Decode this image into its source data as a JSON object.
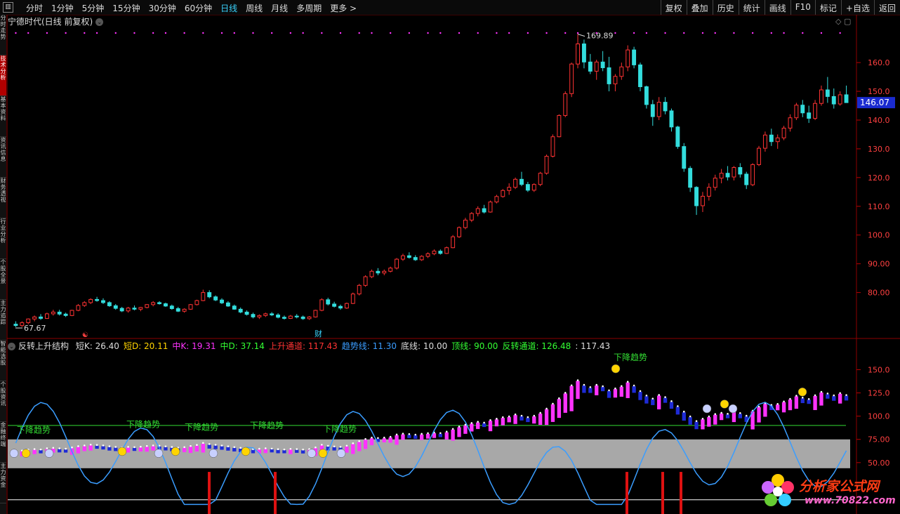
{
  "toolbar": {
    "menu_icon": "menu-icon",
    "periods": [
      "分时",
      "1分钟",
      "5分钟",
      "15分钟",
      "30分钟",
      "60分钟",
      "日线",
      "周线",
      "月线",
      "多周期",
      "更多 >"
    ],
    "active_period": "日线",
    "actions": [
      "复权",
      "叠加",
      "历史",
      "统计",
      "画线",
      "F10",
      "标记",
      "+自选",
      "返回"
    ]
  },
  "sidebar": {
    "tabs": [
      "分时走势",
      "技术分析",
      "基本资料",
      "资讯信息",
      "财务透视",
      "行业分析",
      "个股全景",
      "主力追踪",
      "智能选股",
      "个股资讯",
      "金融终端",
      "主力资金"
    ],
    "active_index": 1
  },
  "main_title": "宁德时代(日线 前复权)",
  "price_axis": {
    "labels": [
      "160.0",
      "150.0",
      "140.0",
      "130.0",
      "120.0",
      "110.0",
      "100.0",
      "90.00",
      "80.00"
    ],
    "current_price": "146.07",
    "high_mark": "169.89",
    "low_mark": "67.67",
    "event_marks": [
      "财",
      "☯"
    ]
  },
  "indicator": {
    "name": "反转上升结构",
    "fields": [
      {
        "label": "短K:",
        "value": "26.40",
        "color": "#dddddd"
      },
      {
        "label": "短D:",
        "value": "20.11",
        "color": "#ffd400"
      },
      {
        "label": "中K:",
        "value": "19.31",
        "color": "#ff33ff"
      },
      {
        "label": "中D:",
        "value": "37.14",
        "color": "#33ff33"
      },
      {
        "label": "上升通道:",
        "value": "117.43",
        "color": "#ff3333"
      },
      {
        "label": "趋势线:",
        "value": "11.30",
        "color": "#3a9dff"
      },
      {
        "label": "底线:",
        "value": "10.00",
        "color": "#dddddd"
      },
      {
        "label": "顶线:",
        "value": "90.00",
        "color": "#33ff33"
      },
      {
        "label": "反转通道:",
        "value": "126.48",
        "color": "#33ff33"
      },
      {
        "label": ":",
        "value": "117.43",
        "color": "#dddddd"
      }
    ],
    "axis_labels": [
      "150.0",
      "125.0",
      "100.0",
      "75.00",
      "50.00"
    ],
    "annotations": [
      "下降趋势",
      "下降趋势",
      "下降趋势",
      "下降趋势",
      "下降趋势",
      "下降趋势"
    ]
  },
  "watermark": {
    "line1": "分析家公式网",
    "line2": "www.70822.com"
  },
  "colors": {
    "up": "#ff3333",
    "down": "#33dddd",
    "magenta": "#ff33ff",
    "blue": "#1e2bd6",
    "trend": "#3a9dff",
    "grid": "#8b0000"
  },
  "chart_data": {
    "type": "candlestick",
    "title": "宁德时代(日线 前复权)",
    "ylim": [
      65,
      172
    ],
    "candles": [
      [
        69,
        70,
        68,
        68.5
      ],
      [
        68.5,
        70,
        68,
        69.5
      ],
      [
        69.5,
        71,
        69,
        70.8
      ],
      [
        70.8,
        72,
        70,
        71.5
      ],
      [
        71.5,
        72.5,
        70.5,
        71
      ],
      [
        71,
        73,
        70.8,
        72.6
      ],
      [
        72.6,
        74,
        72,
        73.2
      ],
      [
        73.2,
        74,
        72,
        72.5
      ],
      [
        72.5,
        73,
        71.5,
        72
      ],
      [
        72,
        74,
        71.8,
        73.8
      ],
      [
        73.8,
        76,
        73.5,
        75.5
      ],
      [
        75.5,
        77,
        75,
        76.5
      ],
      [
        76.5,
        78,
        76,
        77.6
      ],
      [
        77.6,
        78.5,
        76.8,
        77.2
      ],
      [
        77.2,
        78,
        76,
        76.5
      ],
      [
        76.5,
        77,
        75,
        75.4
      ],
      [
        75.4,
        76,
        74,
        74.5
      ],
      [
        74.5,
        75,
        73.2,
        73.6
      ],
      [
        73.6,
        75,
        73,
        74.6
      ],
      [
        74.6,
        75.5,
        73.8,
        74.2
      ],
      [
        74.2,
        75,
        73.5,
        74.8
      ],
      [
        74.8,
        76,
        74.5,
        75.8
      ],
      [
        75.8,
        77,
        75.2,
        76.5
      ],
      [
        76.5,
        77,
        75.8,
        76.1
      ],
      [
        76.1,
        76.5,
        75,
        75.3
      ],
      [
        75.3,
        75.8,
        74,
        74.4
      ],
      [
        74.4,
        75,
        73.2,
        73.5
      ],
      [
        73.5,
        74.5,
        73,
        74.2
      ],
      [
        74.2,
        76,
        74,
        75.8
      ],
      [
        75.8,
        77.5,
        75.5,
        77.2
      ],
      [
        77.2,
        81,
        77,
        80
      ],
      [
        80,
        80.8,
        78,
        78.5
      ],
      [
        78.5,
        79,
        77,
        77.4
      ],
      [
        77.4,
        78,
        76,
        76.4
      ],
      [
        76.4,
        77,
        75,
        75.3
      ],
      [
        75.3,
        75.8,
        74,
        74.2
      ],
      [
        74.2,
        74.8,
        72.8,
        73.2
      ],
      [
        73.2,
        73.8,
        72,
        72.4
      ],
      [
        72.4,
        73,
        71,
        71.5
      ],
      [
        71.5,
        72.4,
        70.8,
        72
      ],
      [
        72,
        73,
        71.5,
        72.6
      ],
      [
        72.6,
        73.2,
        71.8,
        72.2
      ],
      [
        72.2,
        72.8,
        71,
        71.4
      ],
      [
        71.4,
        72,
        70.6,
        71
      ],
      [
        71,
        72.2,
        70.8,
        71.8
      ],
      [
        71.8,
        72.5,
        71,
        71.5
      ],
      [
        71.5,
        72,
        70.5,
        70.9
      ],
      [
        70.9,
        71.8,
        70.5,
        71.5
      ],
      [
        71.5,
        74,
        71.3,
        73.8
      ],
      [
        73.8,
        78,
        73.5,
        77.5
      ],
      [
        77.5,
        78.2,
        75.5,
        76
      ],
      [
        76,
        76.8,
        74.8,
        75.2
      ],
      [
        75.2,
        75.8,
        74,
        74.6
      ],
      [
        74.6,
        76.5,
        74.3,
        76.2
      ],
      [
        76.2,
        80,
        76,
        79.5
      ],
      [
        79.5,
        83,
        79,
        82.5
      ],
      [
        82.5,
        86,
        82,
        85.5
      ],
      [
        85.5,
        88,
        85,
        87.4
      ],
      [
        87.4,
        88.5,
        86,
        86.8
      ],
      [
        86.8,
        88,
        86,
        87.4
      ],
      [
        87.4,
        89,
        87,
        88.5
      ],
      [
        88.5,
        92,
        88,
        91.6
      ],
      [
        91.6,
        93.5,
        91,
        92.8
      ],
      [
        92.8,
        94,
        91.8,
        92.2
      ],
      [
        92.2,
        93,
        91,
        91.4
      ],
      [
        91.4,
        93,
        91,
        92.6
      ],
      [
        92.6,
        94,
        92,
        93.5
      ],
      [
        93.5,
        95,
        93,
        94.4
      ],
      [
        94.4,
        95,
        93.2,
        93.6
      ],
      [
        93.6,
        96,
        93.4,
        95.6
      ],
      [
        95.6,
        100,
        95.4,
        99.4
      ],
      [
        99.4,
        103,
        99,
        102.6
      ],
      [
        102.6,
        106,
        102,
        105.2
      ],
      [
        105.2,
        108,
        104.5,
        107.5
      ],
      [
        107.5,
        110,
        106.5,
        109.2
      ],
      [
        109.2,
        110.5,
        107.5,
        108
      ],
      [
        108,
        112,
        107.8,
        111.5
      ],
      [
        111.5,
        114,
        111,
        113.4
      ],
      [
        113.4,
        116,
        113,
        115.5
      ],
      [
        115.5,
        118,
        114,
        116.6
      ],
      [
        116.6,
        120,
        116,
        119.4
      ],
      [
        119.4,
        122,
        117,
        117.6
      ],
      [
        117.6,
        118.5,
        115,
        115.6
      ],
      [
        115.6,
        118,
        115,
        117.6
      ],
      [
        117.6,
        122,
        117,
        121.5
      ],
      [
        121.5,
        128,
        121,
        127.4
      ],
      [
        127.4,
        135,
        127,
        134.2
      ],
      [
        134.2,
        142,
        134,
        141.6
      ],
      [
        141.6,
        150,
        141,
        149.2
      ],
      [
        149.2,
        160,
        148,
        159.5
      ],
      [
        159.5,
        169.89,
        158,
        166.5
      ],
      [
        166.5,
        168,
        158,
        160.2
      ],
      [
        160.2,
        163,
        156,
        157
      ],
      [
        157,
        161,
        154,
        160.2
      ],
      [
        160.2,
        164,
        157,
        158.2
      ],
      [
        158.2,
        162,
        150,
        152.6
      ],
      [
        152.6,
        156,
        150,
        155.2
      ],
      [
        155.2,
        160,
        154,
        158.5
      ],
      [
        158.5,
        166,
        157,
        164.4
      ],
      [
        164.4,
        165.5,
        158,
        159.2
      ],
      [
        159.2,
        160,
        150,
        151.6
      ],
      [
        151.6,
        152,
        144,
        145.4
      ],
      [
        145.4,
        147,
        138,
        141.2
      ],
      [
        141.2,
        148,
        140,
        146.2
      ],
      [
        146.2,
        148,
        142,
        143.2
      ],
      [
        143.2,
        144,
        136,
        137.6
      ],
      [
        137.6,
        138,
        130,
        130.8
      ],
      [
        130.8,
        132,
        122,
        123.2
      ],
      [
        123.2,
        124,
        115,
        116.6
      ],
      [
        116.6,
        117,
        107,
        110.2
      ],
      [
        110.2,
        115,
        108,
        113.5
      ],
      [
        113.5,
        118,
        112,
        116.6
      ],
      [
        116.6,
        121,
        115.5,
        119.8
      ],
      [
        119.8,
        123,
        118,
        121.5
      ],
      [
        121.5,
        124,
        119,
        120.2
      ],
      [
        120.2,
        124,
        119,
        123.5
      ],
      [
        123.5,
        125,
        120,
        121.2
      ],
      [
        121.2,
        122,
        116,
        117.5
      ],
      [
        117.5,
        125,
        117,
        124.5
      ],
      [
        124.5,
        131,
        124,
        130.2
      ],
      [
        130.2,
        136,
        129,
        134.8
      ],
      [
        134.8,
        137,
        131,
        132.5
      ],
      [
        132.5,
        135,
        130,
        133.8
      ],
      [
        133.8,
        138,
        133,
        137.2
      ],
      [
        137.2,
        142,
        136,
        140.8
      ],
      [
        140.8,
        146,
        140,
        145.2
      ],
      [
        145.2,
        147,
        141,
        142.5
      ],
      [
        142.5,
        145,
        139,
        140.6
      ],
      [
        140.6,
        147,
        140,
        145.8
      ],
      [
        145.8,
        152,
        145,
        150.5
      ],
      [
        150.5,
        155,
        146,
        148.2
      ],
      [
        148.2,
        151,
        144,
        145.6
      ],
      [
        145.6,
        150,
        145,
        148.8
      ],
      [
        148.8,
        152,
        146,
        146.07
      ]
    ],
    "osc_labels": [
      "下降趋势",
      "下降趋势",
      "下降趋势",
      "下降趋势",
      "下降趋势",
      "下降趋势"
    ]
  }
}
